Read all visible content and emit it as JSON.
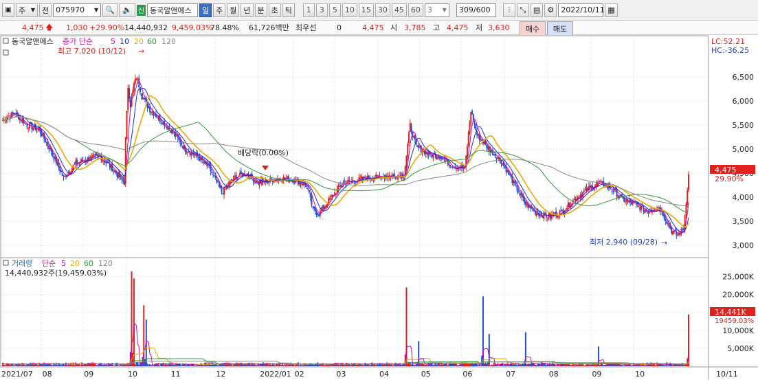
{
  "toolbar": {
    "period_label": "주",
    "prev_label": "전",
    "code": "075970",
    "stock_name": "동국알앤에스",
    "new_badge": "신",
    "period_tabs": [
      "일",
      "주",
      "월",
      "년",
      "분",
      "초",
      "틱"
    ],
    "selected_tab": "일",
    "minute_options": [
      "1",
      "3",
      "5",
      "10",
      "15",
      "30",
      "45",
      "60"
    ],
    "count_select": "3",
    "bar_count": "309",
    "bar_total": "/600",
    "date": "2022/10/11"
  },
  "quote": {
    "price": "4,475",
    "change": "1,030",
    "change_pct": "+29.90%",
    "volume": "14,440,932",
    "volume_pct": "9,459.03%",
    "ratio": "78.48%",
    "amount": "61,726백만",
    "best_bid_label": "최우선",
    "best_bid": "0",
    "current": "4,475",
    "open_label": "시",
    "open": "3,785",
    "high_label": "고",
    "high": "4,475",
    "low_label": "저",
    "low": "3,630",
    "buy_label": "매수",
    "sell_label": "매도"
  },
  "price_panel": {
    "name": "동국알앤에스",
    "legend_prefix": "종가 단순",
    "ma_periods": [
      "5",
      "10",
      "20",
      "60",
      "120"
    ],
    "max_label": "최고 7,020 (10/12)",
    "min_label": "최저 2,940 (09/28)",
    "dividend_label": "배당락(0.00%)",
    "lc_label": "LC:52.21",
    "hc_label": "HC:-36.25",
    "current_tag": "4,475",
    "current_pct_tag": "29.90%",
    "y_ticks": [
      "6,500",
      "6,000",
      "5,500",
      "5,000",
      "4,500",
      "4,000",
      "3,500",
      "3,000"
    ]
  },
  "volume_panel": {
    "name": "거래량",
    "legend_prefix": "단순",
    "ma_periods": [
      "5",
      "20",
      "60",
      "120"
    ],
    "summary": "14,440,932주(19,459.03%)",
    "current_tag": "14,441K",
    "current_pct_tag": "19459.03%",
    "y_ticks": [
      "25,000K",
      "20,000K",
      "15,000K",
      "10,000K",
      "5,000K"
    ]
  },
  "x_axis": [
    "2021/07",
    "08",
    "09",
    "10",
    "11",
    "12",
    "2022/01",
    "02",
    "03",
    "04",
    "05",
    "06",
    "07",
    "08",
    "09",
    "10",
    "10/11"
  ],
  "colors": {
    "up": "#e0211c",
    "down": "#1f4fd6",
    "ma5": "#d400a8",
    "ma10": "#1a2bd8",
    "ma20": "#e8a800",
    "ma60": "#2e9a3a",
    "ma120": "#888888"
  },
  "chart_data": {
    "type": "candlestick",
    "x_range": [
      "2021/07",
      "2022/10/11"
    ],
    "price_ylim": [
      2800,
      7200
    ],
    "price_anchors": [
      [
        0,
        5600
      ],
      [
        10,
        5750
      ],
      [
        20,
        5500
      ],
      [
        30,
        5400
      ],
      [
        40,
        4950
      ],
      [
        50,
        4400
      ],
      [
        60,
        4700
      ],
      [
        70,
        4800
      ],
      [
        80,
        4850
      ],
      [
        90,
        4600
      ],
      [
        100,
        4300
      ],
      [
        101,
        5200
      ],
      [
        103,
        6300
      ],
      [
        105,
        5900
      ],
      [
        108,
        6350
      ],
      [
        110,
        6500
      ],
      [
        114,
        6150
      ],
      [
        120,
        5850
      ],
      [
        130,
        5600
      ],
      [
        140,
        5350
      ],
      [
        150,
        5000
      ],
      [
        160,
        4850
      ],
      [
        170,
        4600
      ],
      [
        180,
        4100
      ],
      [
        190,
        4400
      ],
      [
        200,
        4500
      ],
      [
        210,
        4300
      ],
      [
        220,
        4350
      ],
      [
        230,
        4400
      ],
      [
        240,
        4350
      ],
      [
        250,
        4250
      ],
      [
        255,
        3750
      ],
      [
        260,
        3650
      ],
      [
        270,
        4000
      ],
      [
        280,
        4300
      ],
      [
        300,
        4400
      ],
      [
        320,
        4450
      ],
      [
        330,
        4450
      ],
      [
        335,
        5500
      ],
      [
        340,
        5050
      ],
      [
        350,
        4900
      ],
      [
        360,
        4850
      ],
      [
        370,
        4650
      ],
      [
        380,
        4600
      ],
      [
        385,
        5800
      ],
      [
        390,
        5300
      ],
      [
        400,
        5000
      ],
      [
        410,
        4750
      ],
      [
        420,
        4300
      ],
      [
        430,
        3850
      ],
      [
        440,
        3650
      ],
      [
        450,
        3600
      ],
      [
        460,
        3700
      ],
      [
        470,
        3950
      ],
      [
        480,
        4150
      ],
      [
        490,
        4300
      ],
      [
        500,
        4200
      ],
      [
        510,
        3950
      ],
      [
        520,
        3850
      ],
      [
        530,
        3700
      ],
      [
        540,
        3800
      ],
      [
        550,
        3300
      ],
      [
        555,
        3200
      ],
      [
        560,
        3350
      ],
      [
        564,
        4475
      ]
    ],
    "volume_ylim": [
      0,
      28000
    ],
    "volume_spikes": [
      [
        106,
        26500
      ],
      [
        108,
        24500
      ],
      [
        116,
        17000
      ],
      [
        118,
        13000
      ],
      [
        332,
        22000
      ],
      [
        342,
        7000
      ],
      [
        395,
        19500
      ],
      [
        400,
        9000
      ],
      [
        430,
        9500
      ],
      [
        490,
        5500
      ],
      [
        564,
        14441
      ]
    ]
  }
}
